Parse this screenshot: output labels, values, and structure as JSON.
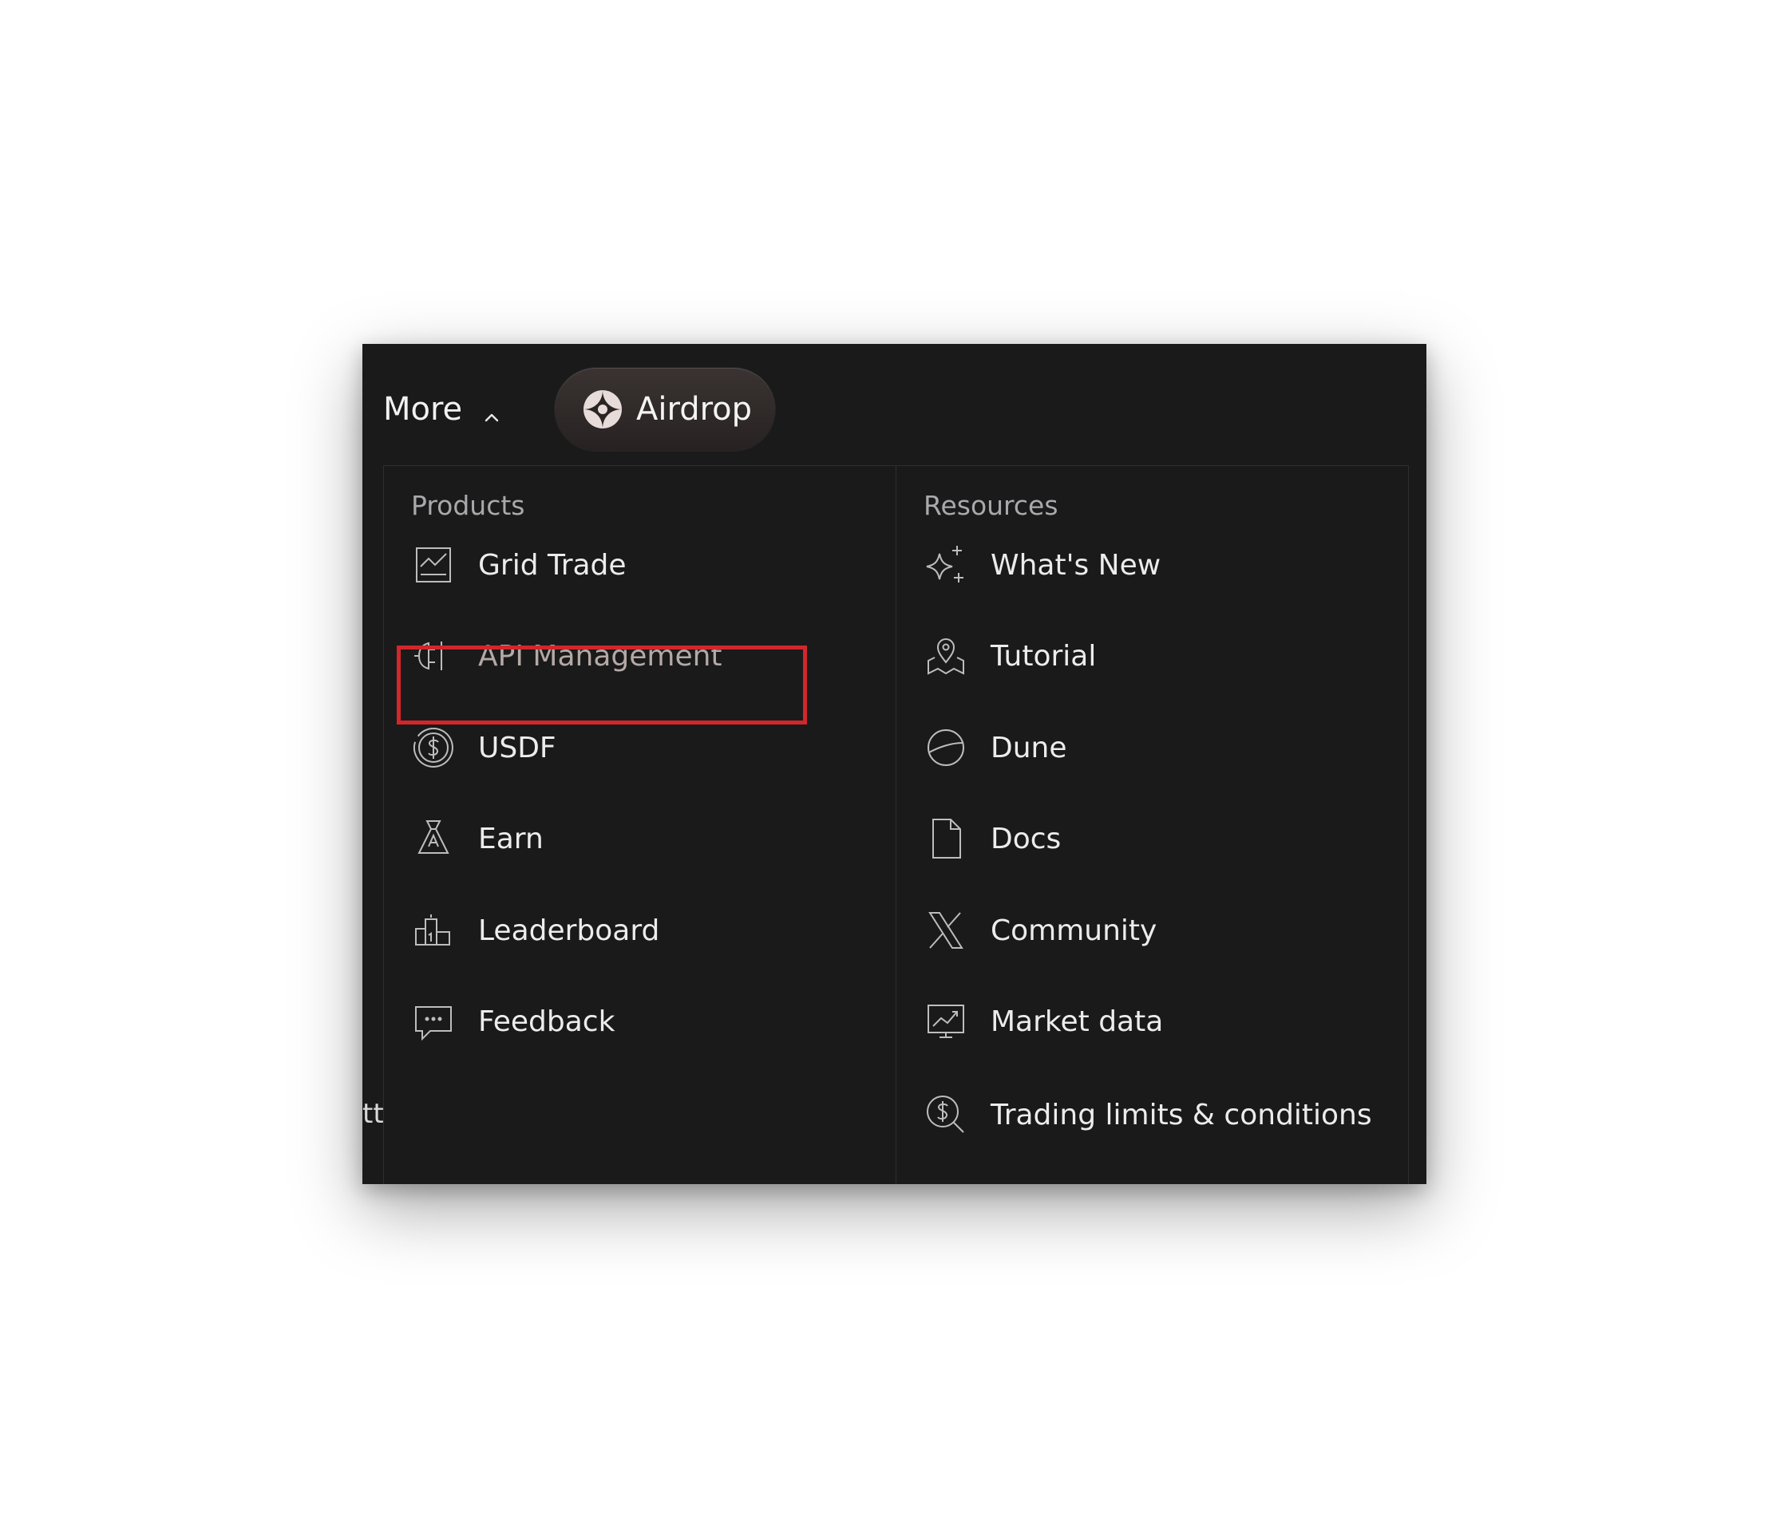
{
  "topbar": {
    "more_label": "More",
    "airdrop_label": "Airdrop"
  },
  "products": {
    "title": "Products",
    "items": [
      {
        "label": "Grid Trade",
        "icon": "chart-board-icon"
      },
      {
        "label": "API Management",
        "icon": "plug-icon",
        "highlighted": true
      },
      {
        "label": "USDF",
        "icon": "dollar-circle-icon"
      },
      {
        "label": "Earn",
        "icon": "money-bag-icon"
      },
      {
        "label": "Leaderboard",
        "icon": "podium-icon"
      },
      {
        "label": "Feedback",
        "icon": "chat-bubble-icon"
      }
    ]
  },
  "resources": {
    "title": "Resources",
    "items": [
      {
        "label": "What's New",
        "icon": "sparkle-icon"
      },
      {
        "label": "Tutorial",
        "icon": "map-pin-icon"
      },
      {
        "label": "Dune",
        "icon": "globe-half-icon"
      },
      {
        "label": "Docs",
        "icon": "document-icon"
      },
      {
        "label": "Community",
        "icon": "x-logo-icon"
      },
      {
        "label": "Market data",
        "icon": "monitor-chart-icon"
      },
      {
        "label": "Trading limits & conditions",
        "icon": "dollar-search-icon"
      }
    ]
  },
  "edge_text": "tt",
  "colors": {
    "panel_bg": "#1a1a1b",
    "highlight": "#d3262b",
    "text": "#ececec",
    "muted": "#a9a9ac"
  }
}
